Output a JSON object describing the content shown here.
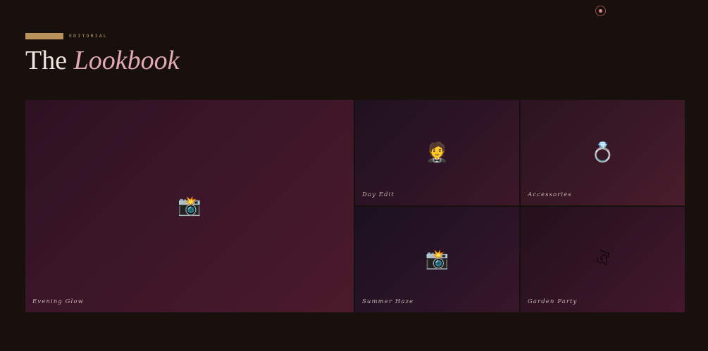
{
  "header": {
    "eyebrow": "EDITORIAL",
    "title_main": "The",
    "title_accent": "Lookbook"
  },
  "icons": {
    "top_button": "record-dot-icon"
  },
  "tiles": [
    {
      "caption": "Evening Glow",
      "icon": "📸",
      "icon_name": "camera-flash-icon"
    },
    {
      "caption": "Day Edit",
      "icon": "🤵",
      "icon_name": "person-tuxedo-icon"
    },
    {
      "caption": "Accessories",
      "icon": "💍",
      "icon_name": "ring-icon"
    },
    {
      "caption": "Summer Haze",
      "icon": "📸",
      "icon_name": "camera-flash-icon"
    },
    {
      "caption": "Garden Party",
      "icon": "ঐ",
      "icon_name": "glyph-icon"
    }
  ],
  "colors": {
    "background": "#17100c",
    "eyebrow_bar": "#b9935b",
    "title_text": "#efe6dd",
    "title_accent": "#e3a9b3",
    "caption_text": "#cbb7b1"
  }
}
